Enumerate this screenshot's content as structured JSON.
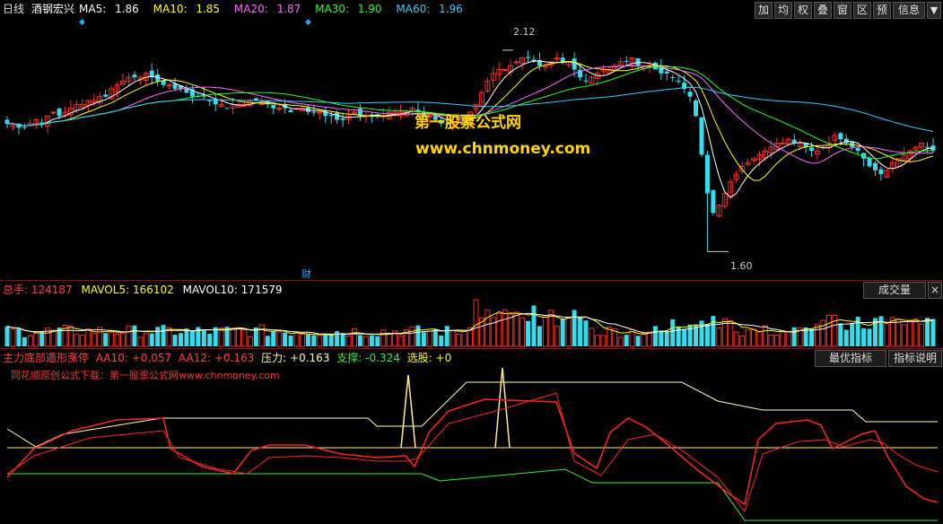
{
  "header": {
    "period": "日线",
    "stock_name": "酒钢宏兴",
    "ma": [
      {
        "label": "MA5:",
        "value": "1.86",
        "color": "#ffffff"
      },
      {
        "label": "MA10:",
        "value": "1.85",
        "color": "#ffff00"
      },
      {
        "label": "MA20:",
        "value": "1.87",
        "color": "#ff66ff"
      },
      {
        "label": "MA30:",
        "value": "1.90",
        "color": "#22ff22"
      },
      {
        "label": "MA60:",
        "value": "1.96",
        "color": "#33ccff"
      }
    ],
    "toolbar": [
      "加",
      "均",
      "权",
      "叠",
      "窗",
      "区",
      "预",
      "信息",
      "▼"
    ]
  },
  "price_chart": {
    "high_label": "2.12",
    "low_label": "1.60",
    "event_label": "财",
    "watermark_title": "第一股票公式网",
    "watermark_url": "www.chnmoney.com"
  },
  "volume_header": {
    "total_label": "总手:",
    "total_value": "124187",
    "mavol5_label": "MAVOL5:",
    "mavol5_value": "166102",
    "mavol10_label": "MAVOL10:",
    "mavol10_value": "171579",
    "dropdown_label": "成交量",
    "close_icon": "×"
  },
  "indicator_header": {
    "name": "主力底部遁形涨停",
    "aa10_label": "AA10:",
    "aa10_value": "+0.057",
    "aa12_label": "AA12:",
    "aa12_value": "+0.163",
    "pressure_label": "压力:",
    "pressure_value": "+0.163",
    "support_label": "支撑:",
    "support_value": "-0.324",
    "pick_label": "选股:",
    "pick_value": "+0",
    "best_button": "最优指标",
    "explain_button": "指标说明",
    "close_icon": "×",
    "download_text": "同花顺原创公式下载：第一股票公式网www.chnmoney.com"
  },
  "colors": {
    "up": "#ff2a2a",
    "down": "#33ddee",
    "ma5": "#ffffff",
    "ma10": "#ffff00",
    "ma20": "#ff66ff",
    "ma30": "#22ff22",
    "ma60": "#33ccff",
    "indicator_red": "#ff2222",
    "indicator_light": "#ffffaa",
    "indicator_green": "#33ee33",
    "indicator_level": "#ffee88"
  },
  "chart_data": [
    {
      "type": "candlestick",
      "title": "",
      "ylim": [
        1.55,
        2.18
      ],
      "series": [
        {
          "name": "MA5",
          "values": [
            1.86
          ]
        },
        {
          "name": "MA10",
          "values": [
            1.85
          ]
        },
        {
          "name": "MA20",
          "values": [
            1.87
          ]
        },
        {
          "name": "MA30",
          "values": [
            1.9
          ]
        },
        {
          "name": "MA60",
          "values": [
            1.96
          ]
        }
      ],
      "annotations": [
        {
          "text": "2.12",
          "value": 2.12,
          "kind": "high"
        },
        {
          "text": "1.60",
          "value": 1.6,
          "kind": "low"
        }
      ],
      "close_path": [
        1.93,
        1.93,
        1.92,
        1.92,
        1.93,
        1.94,
        1.93,
        1.95,
        1.96,
        1.95,
        1.96,
        1.97,
        1.98,
        1.98,
        1.99,
        1.99,
        2.0,
        2.0,
        2.02,
        2.03,
        2.04,
        2.05,
        2.05,
        2.05,
        2.06,
        2.05,
        2.04,
        2.03,
        2.03,
        2.02,
        2.02,
        2.01,
        2.0,
        2.0,
        2.0,
        1.99,
        1.98,
        1.98,
        1.97,
        1.98,
        1.98,
        1.98,
        1.99,
        1.99,
        1.99,
        1.98,
        1.97,
        1.97,
        1.97,
        1.96,
        1.97,
        1.97,
        1.96,
        1.96,
        1.96,
        1.95,
        1.95,
        1.94,
        1.94,
        1.95,
        1.96,
        1.95,
        1.95,
        1.95,
        1.95,
        1.95,
        1.96,
        1.96,
        1.96,
        1.96,
        1.97,
        1.96,
        1.95,
        1.95,
        1.94,
        1.93,
        1.93,
        1.93,
        1.94,
        1.94,
        1.96,
        1.98,
        2.01,
        2.04,
        2.06,
        2.07,
        2.07,
        2.08,
        2.09,
        2.1,
        2.1,
        2.09,
        2.08,
        2.08,
        2.09,
        2.1,
        2.09,
        2.09,
        2.07,
        2.05,
        2.04,
        2.05,
        2.06,
        2.07,
        2.07,
        2.08,
        2.09,
        2.09,
        2.1,
        2.08,
        2.08,
        2.08,
        2.07,
        2.06,
        2.06,
        2.05,
        2.04,
        2.02,
        2.0,
        1.95,
        1.85,
        1.75,
        1.7,
        1.72,
        1.75,
        1.78,
        1.8,
        1.82,
        1.83,
        1.84,
        1.85,
        1.86,
        1.87,
        1.88,
        1.88,
        1.89,
        1.88,
        1.88,
        1.87,
        1.86,
        1.86,
        1.87,
        1.88,
        1.9,
        1.89,
        1.88,
        1.87,
        1.86,
        1.84,
        1.82,
        1.81,
        1.8,
        1.81,
        1.83,
        1.84,
        1.85,
        1.86,
        1.87,
        1.88,
        1.87,
        1.86
      ]
    },
    {
      "type": "bar",
      "title": "",
      "series": [
        {
          "name": "MAVOL5",
          "values": [
            166102
          ]
        },
        {
          "name": "MAVOL10",
          "values": [
            171579
          ]
        }
      ],
      "last_value": 124187
    },
    {
      "type": "line",
      "title": "",
      "series": [
        {
          "name": "AA10",
          "values": [
            0.057
          ]
        },
        {
          "name": "AA12",
          "values": [
            0.163
          ]
        },
        {
          "name": "压力",
          "values": [
            0.163
          ]
        },
        {
          "name": "支撑",
          "values": [
            -0.324
          ]
        },
        {
          "name": "选股",
          "values": [
            0
          ]
        }
      ]
    }
  ]
}
